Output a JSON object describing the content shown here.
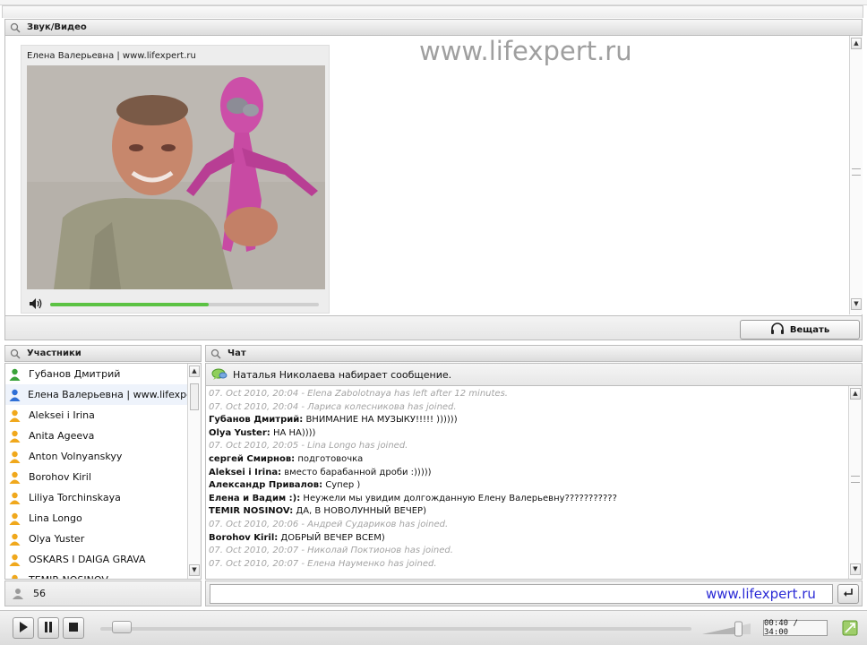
{
  "av_panel": {
    "title": "Звук/Видео",
    "webcam_name": "Елена Валерьевна | www.lifexpert.ru",
    "watermark": "www.lifexpert.ru",
    "volume_level": 0.59,
    "broadcast_label": "Вещать"
  },
  "participants": {
    "title": "Участники",
    "items": [
      {
        "name": "Губанов Дмитрий",
        "role": "moderator"
      },
      {
        "name": "Елена Валерьевна | www.lifexpert.ru",
        "role": "presenter"
      },
      {
        "name": "Aleksei i Irina",
        "role": "guest"
      },
      {
        "name": "Anita Ageeva",
        "role": "guest"
      },
      {
        "name": "Anton Volnyanskyy",
        "role": "guest"
      },
      {
        "name": "Borohov Kiril",
        "role": "guest"
      },
      {
        "name": "Liliya Torchinskaya",
        "role": "guest"
      },
      {
        "name": "Lina Longo",
        "role": "guest"
      },
      {
        "name": "Olya Yuster",
        "role": "guest"
      },
      {
        "name": "OSKARS I DAIGA GRAVA",
        "role": "guest"
      },
      {
        "name": "TEMIR NOSINOV",
        "role": "guest"
      }
    ],
    "count": "56"
  },
  "chat": {
    "title": "Чат",
    "typing_status": "Наталья Николаева набирает сообщение.",
    "messages": [
      {
        "type": "system",
        "text": "07. Oct 2010, 20:04 - Elena Zabolotnaya has left after 12 minutes."
      },
      {
        "type": "system",
        "text": "07. Oct 2010, 20:04 - Лариса колесникова has joined."
      },
      {
        "type": "message",
        "author": "Губанов Дмитрий:",
        "text": " ВНИМАНИЕ НА МУЗЫКУ!!!!! ))))))"
      },
      {
        "type": "message",
        "author": "Olya Yuster:",
        "text": " НА НА))))"
      },
      {
        "type": "system",
        "text": "07. Oct 2010, 20:05 - Lina Longo has joined."
      },
      {
        "type": "message",
        "author": "сергей Смирнов:",
        "text": " подготовочка"
      },
      {
        "type": "message",
        "author": "Aleksei i Irina:",
        "text": " вместо барабанной дроби :)))))"
      },
      {
        "type": "message",
        "author": "Александр Привалов:",
        "text": " Супер )"
      },
      {
        "type": "message",
        "author": "Елена и Вадим :):",
        "text": " Неужели мы увидим долгожданную Елену Валерьевну???????????"
      },
      {
        "type": "message",
        "author": "TEMIR NOSINOV:",
        "text": " ДА, В НОВОЛУННЫЙ ВЕЧЕР)"
      },
      {
        "type": "system",
        "text": "07. Oct 2010, 20:06 - Андрей Судариков has joined."
      },
      {
        "type": "message",
        "author": "Borohov Kiril:",
        "text": " ДОБРЫЙ ВЕЧЕР ВСЕМ)"
      },
      {
        "type": "system",
        "text": "07. Oct 2010, 20:07 - Николай Поктионов has joined."
      },
      {
        "type": "system",
        "text": "07. Oct 2010, 20:07 - Елена Науменко has joined."
      }
    ],
    "input_value": "",
    "input_watermark": "www.lifexpert.ru"
  },
  "player": {
    "time_display": "00:40 / 34:00",
    "progress": 0.02,
    "volume_level": 0.75
  },
  "colors": {
    "moderator_icon": "#3aa33a",
    "presenter_icon": "#2f6fd6",
    "guest_icon": "#f0a81c",
    "volume_fill": "#5bc243",
    "watermark_blue": "#2a2ad6",
    "system_message": "#a4a4a4"
  }
}
